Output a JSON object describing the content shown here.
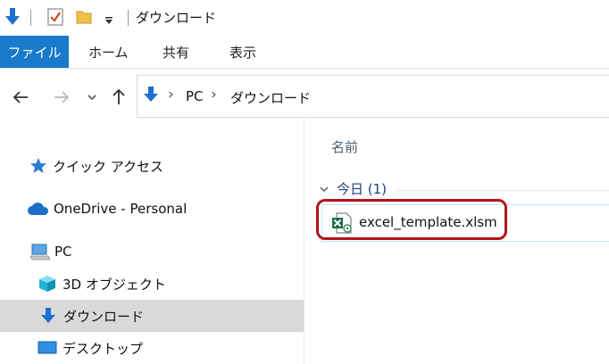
{
  "window": {
    "title": "ダウンロード"
  },
  "ribbon": {
    "tabs": [
      "ファイル",
      "ホーム",
      "共有",
      "表示"
    ]
  },
  "address": {
    "crumbs": [
      "PC",
      "ダウンロード"
    ]
  },
  "nav_pane": {
    "quick_access": "クイック アクセス",
    "onedrive": "OneDrive - Personal",
    "pc": "PC",
    "objects3d": "3D オブジェクト",
    "downloads": "ダウンロード",
    "desktop": "デスクトップ"
  },
  "content": {
    "column_name": "名前",
    "group": {
      "label": "今日 (1)"
    },
    "files": [
      {
        "name": "excel_template.xlsm",
        "icon": "excel-macro-file-icon"
      }
    ]
  },
  "colors": {
    "accent": "#1979ca",
    "highlight_border": "#b2141b",
    "selected_nav": "#d9d9d9"
  },
  "icons": {
    "title_bar": [
      "download-arrow-icon",
      "checkbox-icon",
      "folder-icon",
      "dropdown-icon"
    ],
    "nav": [
      "back-arrow-icon",
      "forward-arrow-icon",
      "recent-dropdown-icon",
      "up-arrow-icon"
    ]
  }
}
